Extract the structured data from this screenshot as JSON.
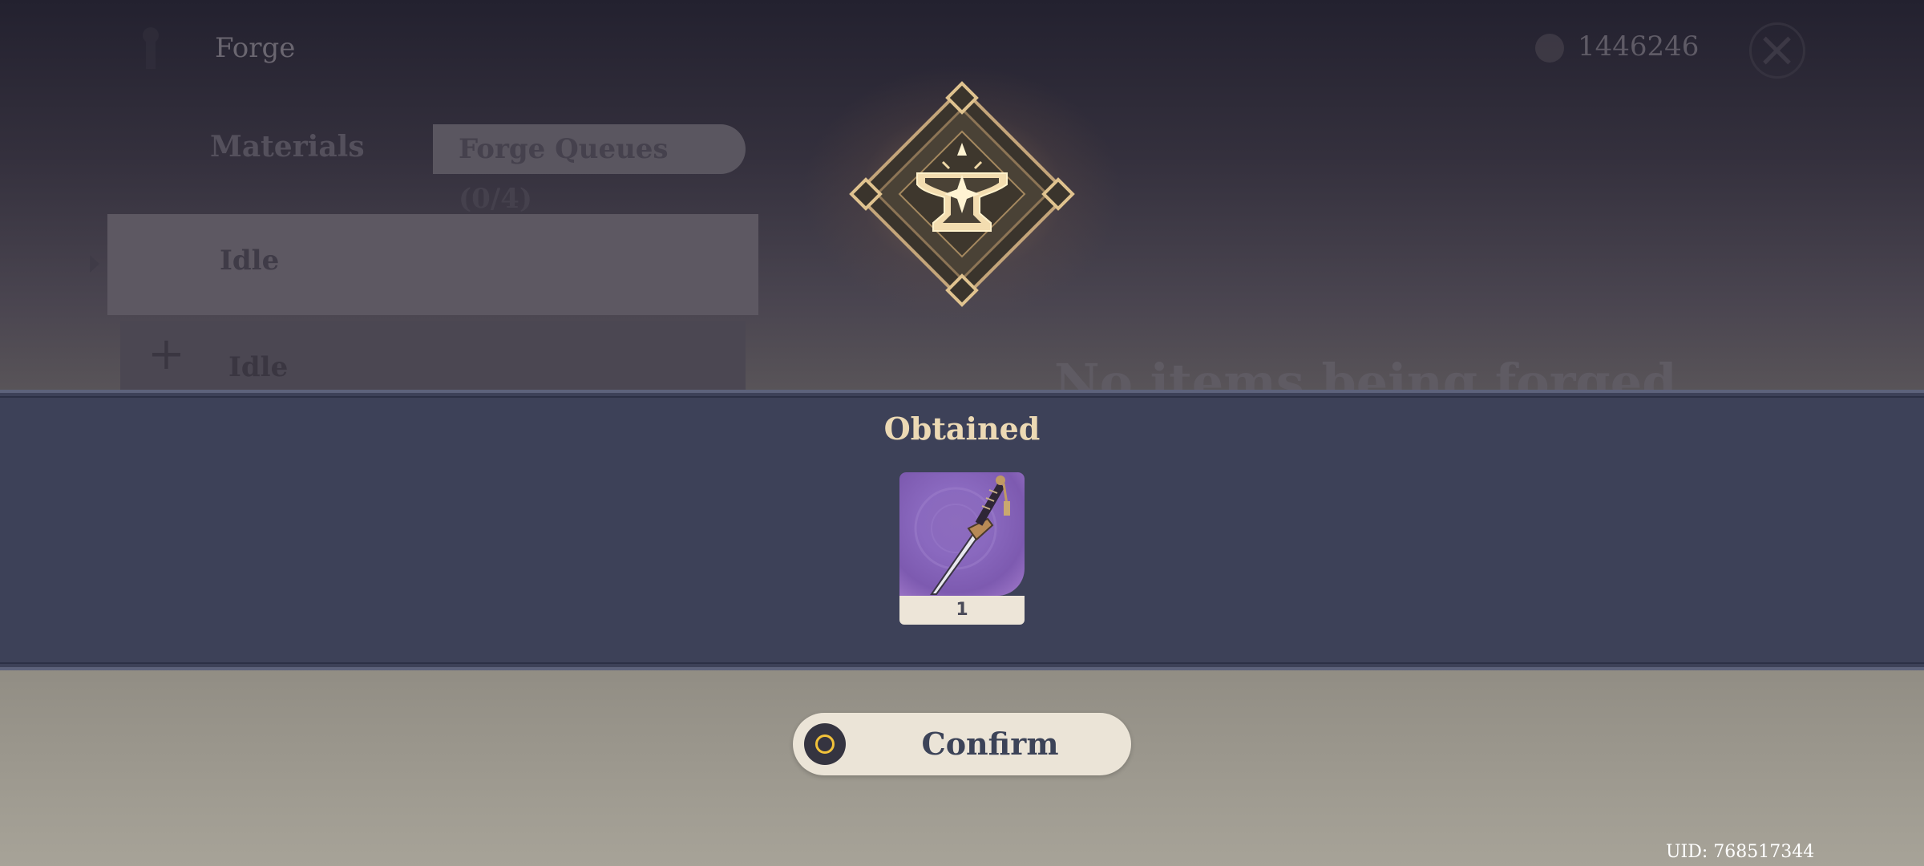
{
  "background": {
    "title": "Forge",
    "mora_count": "1446246",
    "tabs": {
      "materials": "Materials",
      "forge_queues": "Forge Queues (0/4)"
    },
    "queues": [
      {
        "status": "Idle"
      },
      {
        "status": "Idle"
      }
    ],
    "empty_message": "No items being forged"
  },
  "modal": {
    "title": "Obtained",
    "items": [
      {
        "icon": "sword-icon",
        "count": "1"
      }
    ],
    "confirm_label": "Confirm"
  },
  "footer": {
    "uid": "UID: 768517344"
  },
  "colors": {
    "band": "#3d4158",
    "title_gold": "#ecd9b4",
    "item_purple": "#8a69bf",
    "confirm_bg": "#ebe4d7"
  }
}
